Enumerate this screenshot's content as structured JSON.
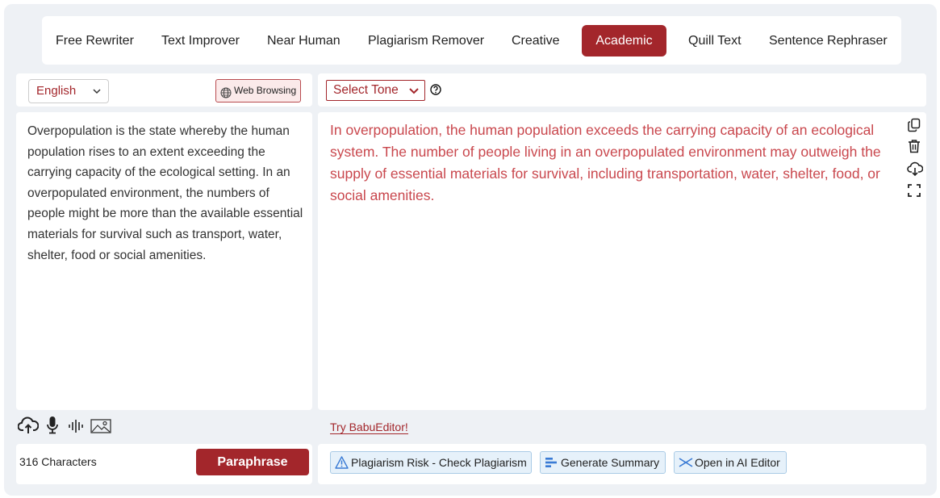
{
  "tabs": [
    {
      "label": "Free Rewriter",
      "active": false
    },
    {
      "label": "Text Improver",
      "active": false
    },
    {
      "label": "Near Human",
      "active": false
    },
    {
      "label": "Plagiarism Remover",
      "active": false
    },
    {
      "label": "Creative",
      "active": false
    },
    {
      "label": "Academic",
      "active": true
    },
    {
      "label": "Quill Text",
      "active": false
    },
    {
      "label": "Sentence Rephraser",
      "active": false
    }
  ],
  "input": {
    "language": "English",
    "web_browsing_label": "Web Browsing",
    "text": "Overpopulation is the state whereby the human population rises to an extent exceeding the carrying capacity of the ecological setting. In an overpopulated environment, the numbers of people might be more than the available essential materials for survival such as transport, water, shelter, food or social amenities.",
    "char_count": "316 Characters",
    "paraphrase_label": "Paraphrase"
  },
  "output": {
    "tone_label": "Select Tone",
    "text": "In overpopulation, the human population exceeds the carrying capacity of an ecological system. The number of people living in an overpopulated environment may outweigh the supply of essential materials for survival, including transportation, water, shelter, food, or social amenities.",
    "try_link": "Try BabuEditor!",
    "actions": [
      {
        "label": "Plagiarism Risk - Check Plagiarism",
        "icon": "warning-icon"
      },
      {
        "label": "Generate Summary",
        "icon": "summary-icon"
      },
      {
        "label": "Open in AI Editor",
        "icon": "ai-editor-icon"
      }
    ]
  },
  "colors": {
    "brand": "#a3262b",
    "output_text": "#c9474d",
    "background": "#eef1f5",
    "action_bg": "#e6f1fa"
  }
}
